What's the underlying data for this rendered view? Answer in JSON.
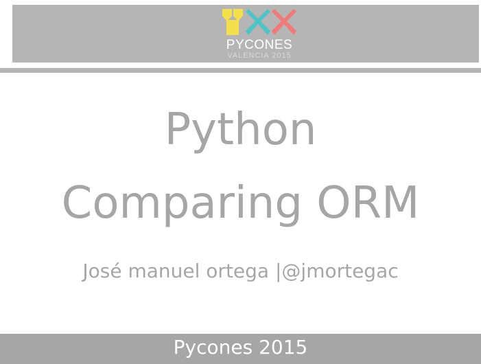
{
  "header": {
    "logo_text": "PYCONES",
    "logo_subtext": "VALENCIA 2015"
  },
  "slide": {
    "title_line1": "Python",
    "title_line2": "Comparing ORM",
    "author": "José manuel ortega |@jmortegac"
  },
  "footer": {
    "text": "Pycones 2015"
  },
  "colors": {
    "logo_yellow": "#f4e04d",
    "logo_teal": "#4fc3c7",
    "logo_coral": "#f07a7a",
    "band_gray": "#b5b5b5",
    "text_gray": "#a6a6a6"
  }
}
